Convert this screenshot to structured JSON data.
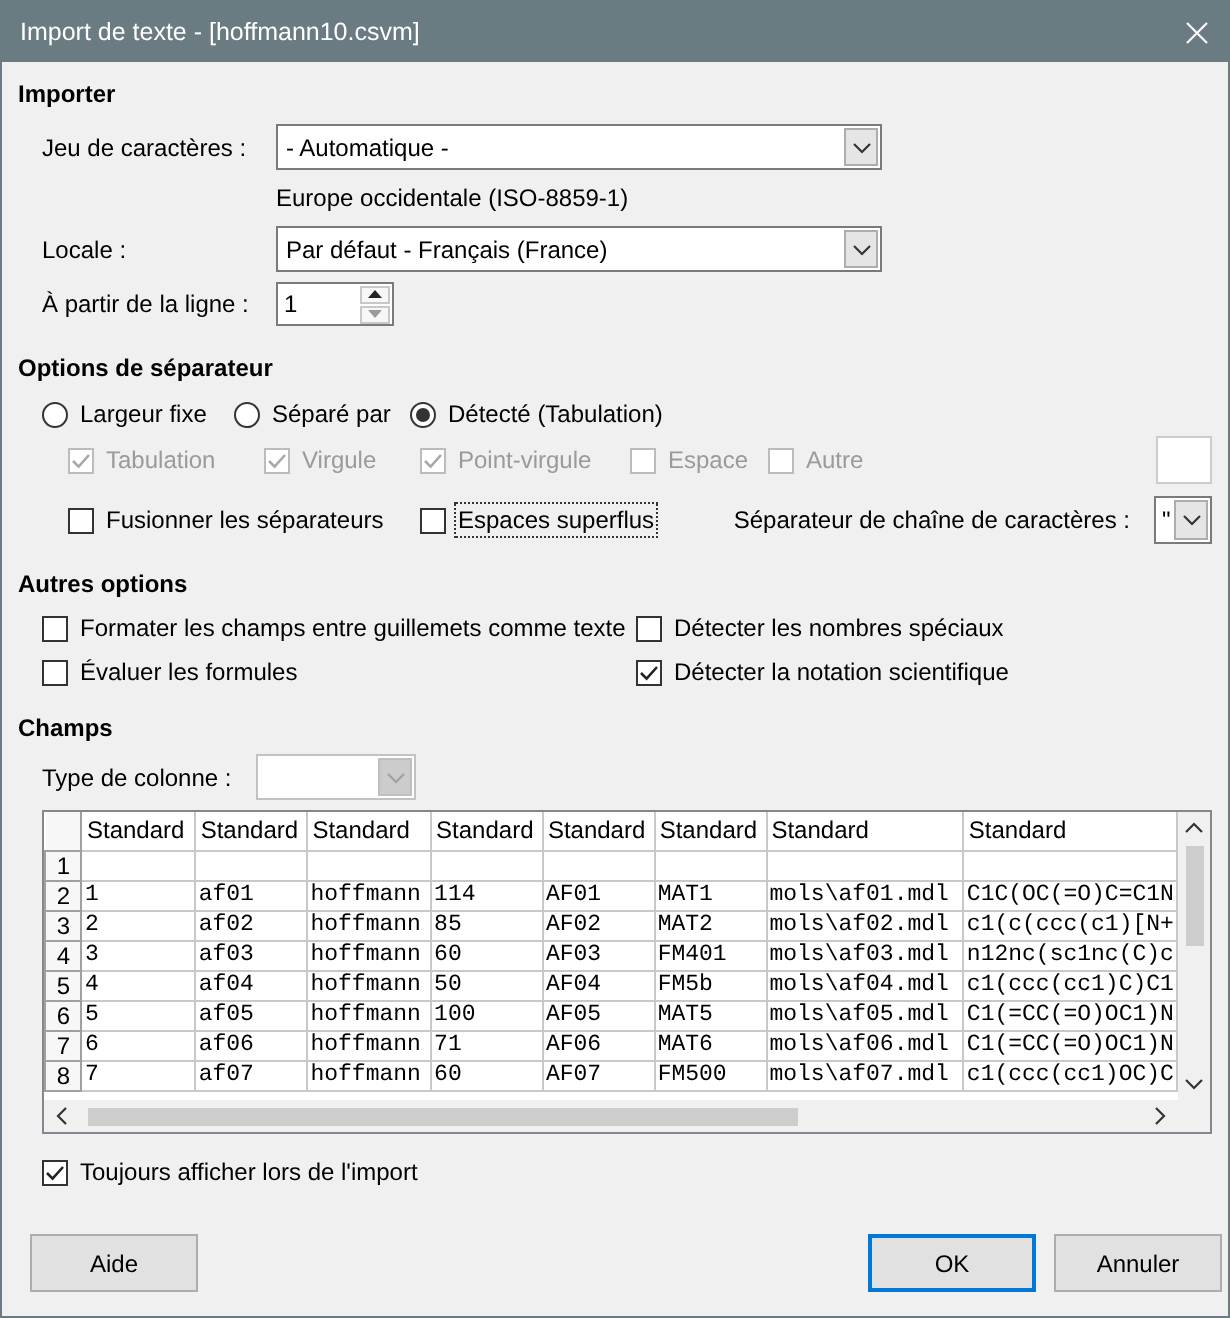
{
  "window": {
    "title": "Import de texte - [hoffmann10.csvm]"
  },
  "import": {
    "heading": "Importer",
    "charset": {
      "label": "Jeu de caractères :",
      "value": "- Automatique -",
      "note": "Europe occidentale (ISO-8859-1)"
    },
    "locale": {
      "label": "Locale :",
      "value": "Par défaut - Français (France)"
    },
    "from_row": {
      "label": "À partir de la ligne :",
      "value": "1"
    }
  },
  "separator_options": {
    "heading": "Options de séparateur",
    "modes": [
      {
        "label": "Largeur fixe",
        "selected": false
      },
      {
        "label": "Séparé par",
        "selected": false
      },
      {
        "label": "Détecté (Tabulation)",
        "selected": true
      }
    ],
    "separators": [
      {
        "label": "Tabulation",
        "checked": true,
        "disabled": true
      },
      {
        "label": "Virgule",
        "checked": true,
        "disabled": true
      },
      {
        "label": "Point-virgule",
        "checked": true,
        "disabled": true
      },
      {
        "label": "Espace",
        "checked": false,
        "disabled": true
      },
      {
        "label": "Autre",
        "checked": false,
        "disabled": true
      }
    ],
    "merge": {
      "label": "Fusionner les séparateurs",
      "checked": false,
      "focused": false
    },
    "trim": {
      "label": "Espaces superflus",
      "checked": false,
      "focused": true
    },
    "string_delimiter": {
      "label": "Séparateur de chaîne de caractères :",
      "value": "\""
    }
  },
  "other_options": {
    "heading": "Autres options",
    "items": [
      {
        "label": "Formater les champs entre guillemets comme texte",
        "checked": false
      },
      {
        "label": "Détecter les nombres spéciaux",
        "checked": false
      },
      {
        "label": "Évaluer les formules",
        "checked": false
      },
      {
        "label": "Détecter la notation scientifique",
        "checked": true
      }
    ]
  },
  "fields": {
    "heading": "Champs",
    "column_type": {
      "label": "Type de colonne :",
      "disabled": true
    },
    "table": {
      "columns": [
        "Standard",
        "Standard",
        "Standard",
        "Standard",
        "Standard",
        "Standard",
        "Standard",
        "Standard"
      ],
      "rows": [
        {
          "number": "1"
        },
        {
          "number": "2",
          "cells": [
            "1",
            "af01",
            "hoffmann",
            "114",
            "AF01",
            "MAT1",
            "mols\\af01.mdl",
            "C1C(OC(=O)C=C1N"
          ]
        },
        {
          "number": "3",
          "cells": [
            "2",
            "af02",
            "hoffmann",
            "85",
            "AF02",
            "MAT2",
            "mols\\af02.mdl",
            "c1(c(ccc(c1)[N+"
          ]
        },
        {
          "number": "4",
          "cells": [
            "3",
            "af03",
            "hoffmann",
            "60",
            "AF03",
            "FM401",
            "mols\\af03.mdl",
            "n12nc(sc1nc(C)c"
          ]
        },
        {
          "number": "5",
          "cells": [
            "4",
            "af04",
            "hoffmann",
            "50",
            "AF04",
            "FM5b",
            "mols\\af04.mdl",
            "c1(ccc(cc1)C)C1"
          ]
        },
        {
          "number": "6",
          "cells": [
            "5",
            "af05",
            "hoffmann",
            "100",
            "AF05",
            "MAT5",
            "mols\\af05.mdl",
            "C1(=CC(=O)OC1)N"
          ]
        },
        {
          "number": "7",
          "cells": [
            "6",
            "af06",
            "hoffmann",
            "71",
            "AF06",
            "MAT6",
            "mols\\af06.mdl",
            "C1(=CC(=O)OC1)N"
          ]
        },
        {
          "number": "8",
          "cells": [
            "7",
            "af07",
            "hoffmann",
            "60",
            "AF07",
            "FM500",
            "mols\\af07.mdl",
            "c1(ccc(cc1)OC)C"
          ]
        }
      ]
    }
  },
  "always_show": {
    "label": "Toujours afficher lors de l'import",
    "checked": true
  },
  "help_button": {
    "label": "Aide"
  },
  "buttons": [
    {
      "label": "OK",
      "default": true
    },
    {
      "label": "Annuler",
      "default": false
    }
  ]
}
